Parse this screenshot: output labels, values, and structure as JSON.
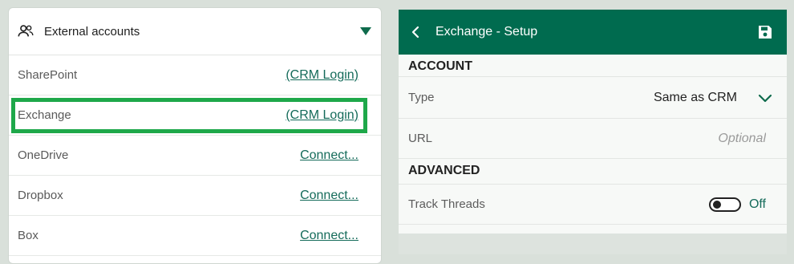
{
  "left_panel": {
    "title": "External accounts",
    "header_icon": "people-icon",
    "collapse_icon": "triangle-down-icon",
    "accounts": [
      {
        "name": "SharePoint",
        "action": "(CRM Login)"
      },
      {
        "name": "Exchange",
        "action": "(CRM Login)",
        "selected": true
      },
      {
        "name": "OneDrive",
        "action": "Connect..."
      },
      {
        "name": "Dropbox",
        "action": "Connect..."
      },
      {
        "name": "Box",
        "action": "Connect..."
      }
    ]
  },
  "right_panel": {
    "title": "Exchange - Setup",
    "back_icon": "chevron-left-icon",
    "save_icon": "save-icon",
    "account_section": "ACCOUNT",
    "type_label": "Type",
    "type_value": "Same as CRM",
    "url_label": "URL",
    "url_placeholder": "Optional",
    "url_value": "",
    "advanced_section": "ADVANCED",
    "track_label": "Track Threads",
    "track_state": "Off"
  },
  "colors": {
    "brand": "#006b4f",
    "link": "#146b5a",
    "highlight": "#1ea84a",
    "background": "#d9e0da"
  }
}
